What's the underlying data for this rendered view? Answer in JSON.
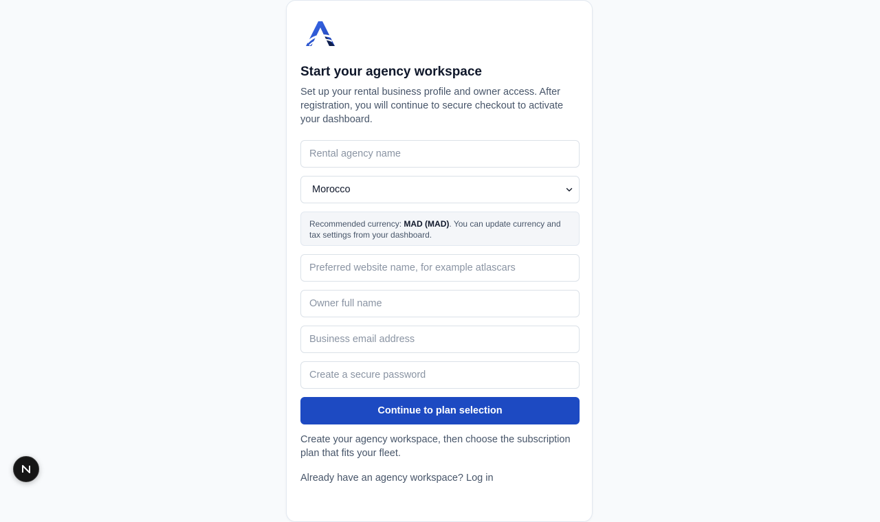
{
  "brand": {
    "logo_icon": "agency-a-logo-icon",
    "accent": "#1d4ac2"
  },
  "header": {
    "title": "Start your agency workspace",
    "subtitle": "Set up your rental business profile and owner access. After registration, you will continue to secure checkout to activate your dashboard."
  },
  "form": {
    "agency_name": {
      "placeholder": "Rental agency name",
      "value": ""
    },
    "country": {
      "selected": "Morocco",
      "icon": "chevron-down-icon"
    },
    "currency_note": {
      "prefix": "Recommended currency: ",
      "currency": "MAD (MAD)",
      "suffix": ". You can update currency and tax settings from your dashboard."
    },
    "website_name": {
      "placeholder": "Preferred website name, for example atlascars",
      "value": ""
    },
    "owner_name": {
      "placeholder": "Owner full name",
      "value": ""
    },
    "email": {
      "placeholder": "Business email address",
      "value": ""
    },
    "password": {
      "placeholder": "Create a secure password",
      "value": ""
    },
    "submit_label": "Continue to plan selection"
  },
  "footer": {
    "helper": "Create your agency workspace, then choose the subscription plan that fits your fleet.",
    "login_prefix": "Already have an agency workspace? ",
    "login_link": "Log in"
  },
  "dev_badge": {
    "letter": "N",
    "icon": "nextjs-dev-indicator-icon"
  }
}
